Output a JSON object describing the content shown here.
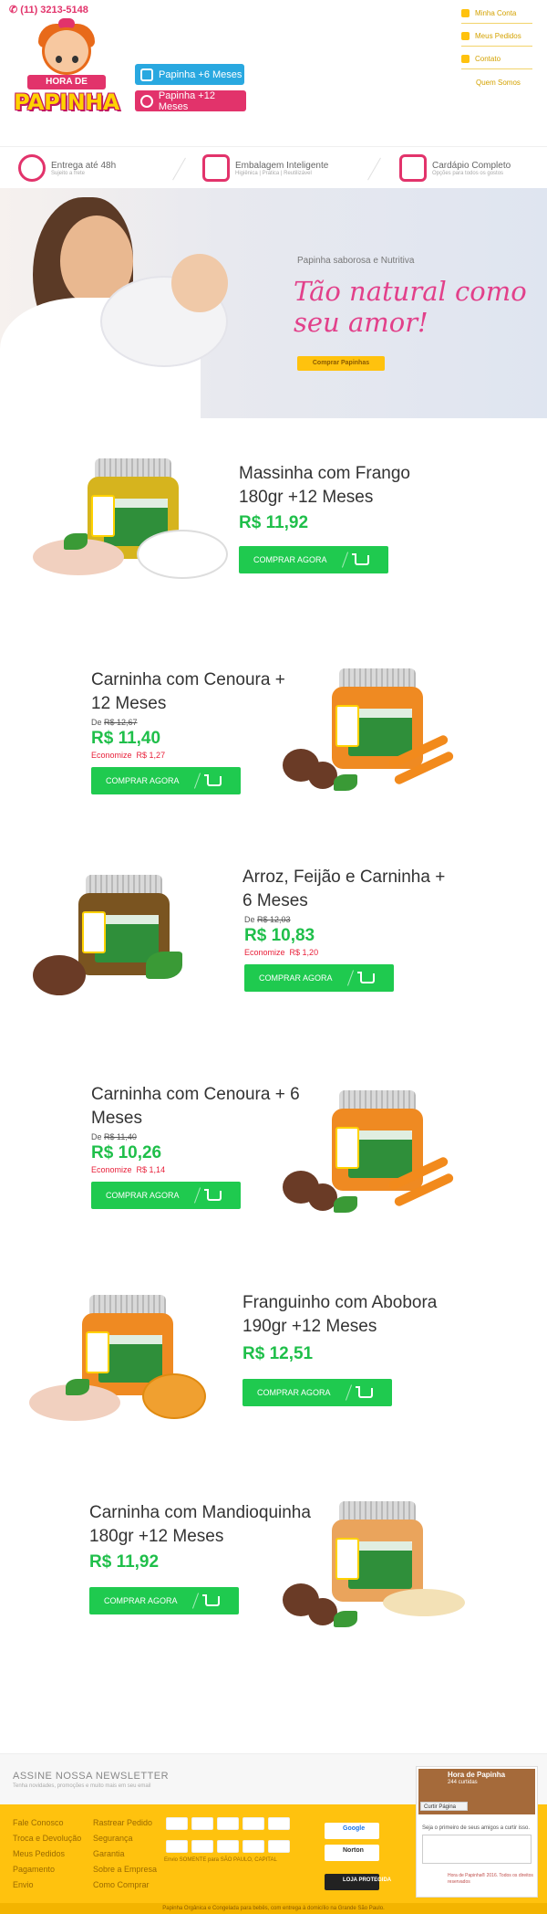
{
  "header": {
    "phone": "(11) 3213-5148",
    "logo_banner": "HORA DE",
    "logo_name": "PAPINHA",
    "age_buttons": [
      "Papinha +6 Meses",
      "Papinha +12 Meses"
    ],
    "account_links": [
      "Minha Conta",
      "Meus Pedidos",
      "Contato"
    ],
    "about": "Quem Somos"
  },
  "features": [
    {
      "title": "Entrega até 48h",
      "sub": "Sujeito a frete"
    },
    {
      "title": "Embalagem Inteligente",
      "sub": "Higiênica | Prática | Reutilizável"
    },
    {
      "title": "Cardápio Completo",
      "sub": "Opções para todos os gostos"
    }
  ],
  "hero": {
    "subtitle": "Papinha saborosa e Nutritiva",
    "title": "Tão natural como seu amor!",
    "button": "Comprar Papinhas"
  },
  "products": [
    {
      "name": "Massinha com Frango 180gr +12 Meses",
      "old": "",
      "price": "R$ 11,92",
      "savings": "",
      "button": "COMPRAR AGORA"
    },
    {
      "name": "Carninha com Cenoura + 12 Meses",
      "old": "R$ 12,67",
      "price": "R$ 11,40",
      "savings": "R$ 1,27",
      "button": "COMPRAR AGORA"
    },
    {
      "name": "Arroz, Feijão e Carninha + 6 Meses",
      "old": "R$ 12,03",
      "price": "R$ 10,83",
      "savings": "R$ 1,20",
      "button": "COMPRAR AGORA"
    },
    {
      "name": "Carninha com Cenoura + 6 Meses",
      "old": "R$ 11,40",
      "price": "R$ 10,26",
      "savings": "R$ 1,14",
      "button": "COMPRAR AGORA"
    },
    {
      "name": "Franguinho com Abobora 190gr +12 Meses",
      "old": "",
      "price": "R$ 12,51",
      "savings": "",
      "button": "COMPRAR AGORA"
    },
    {
      "name": "Carninha com Mandioquinha 180gr +12 Meses",
      "old": "",
      "price": "R$ 11,92",
      "savings": "",
      "button": "COMPRAR AGORA"
    }
  ],
  "labels": {
    "old_prefix": "De",
    "savings_prefix": "Economize"
  },
  "newsletter": {
    "title": "ASSINE NOSSA NEWSLETTER",
    "subtitle": "Tenha novidades, promoções e muito mais em seu email"
  },
  "footer": {
    "col1": [
      "Fale Conosco",
      "Troca e Devolução",
      "Meus Pedidos",
      "Pagamento",
      "Envio"
    ],
    "col2": [
      "Rastrear Pedido",
      "Segurança",
      "Garantia",
      "Sobre a Empresa",
      "Como Comprar"
    ],
    "delivery": "Envio SOMENTE para SÃO PAULO, CAPITAL",
    "seals": [
      "Google",
      "Norton",
      "LOJA PROTEGIDA"
    ],
    "copyright": "Papinha Orgânica e Congelada para bebês, com entrega à domicílio na Grande São Paulo."
  },
  "facebook": {
    "page_name": "Hora de Papinha",
    "likes": "244 curtidas",
    "like_button": "Curtir Página",
    "prompt": "Seja o primeiro de seus amigos a curtir isso.",
    "copyright": "Hora de Papinha® 2016. Todos os direitos reservados"
  },
  "colors": {
    "pink": "#e2336b",
    "yellow": "#ffc20e",
    "green": "#1fca4f",
    "blue": "#29a8e0"
  },
  "icons": [
    "phone-icon",
    "user-icon",
    "cart-icon",
    "bicycle-icon",
    "package-icon",
    "menu-icon"
  ]
}
